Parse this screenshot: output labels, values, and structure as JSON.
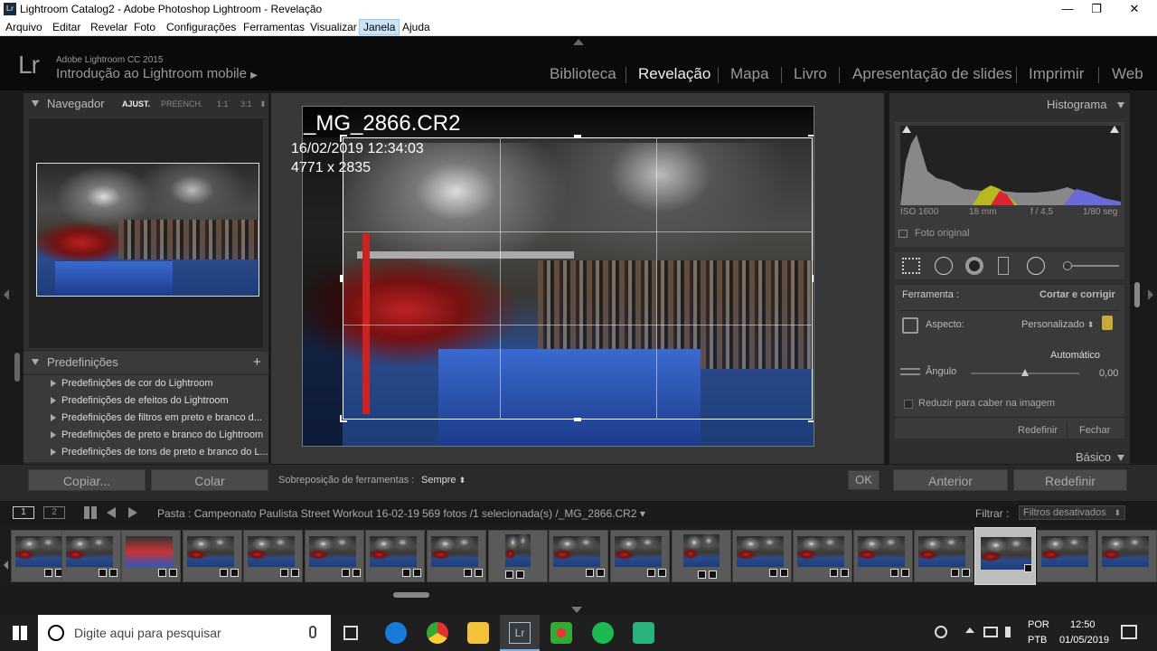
{
  "window": {
    "title": "Lightroom Catalog2 - Adobe Photoshop Lightroom - Revelação",
    "minimize": "—",
    "maximize": "❐",
    "close": "✕"
  },
  "menu": [
    "Arquivo",
    "Editar",
    "Revelar",
    "Foto",
    "Configurações",
    "Ferramentas",
    "Visualizar",
    "Janela",
    "Ajuda"
  ],
  "identity": {
    "logo": "Lr",
    "version": "Adobe Lightroom CC 2015",
    "intro": "Introdução ao Lightroom mobile",
    "intro_arrow": "▶"
  },
  "modules": [
    "Biblioteca",
    "Revelação",
    "Mapa",
    "Livro",
    "Apresentação de slides",
    "Imprimir",
    "Web"
  ],
  "navigator": {
    "title": "Navegador",
    "zoom": [
      "AJUST.",
      "PREENCH.",
      "1:1",
      "3:1"
    ],
    "stepper": "⬍"
  },
  "presets": {
    "title": "Predefinições",
    "add": "+",
    "items": [
      "Predefinições de cor do Lightroom",
      "Predefinições de efeitos do Lightroom",
      "Predefinições de filtros em preto e branco d...",
      "Predefinições de preto e branco do Lightroom",
      "Predefinições de tons de preto e branco do L..."
    ]
  },
  "left_buttons": {
    "copy": "Copiar...",
    "paste": "Colar"
  },
  "photo_info": {
    "filename": "_MG_2866.CR2",
    "datetime": "16/02/2019 12:34:03",
    "dimensions": "4771 x 2835"
  },
  "toolbar": {
    "overlay_label": "Sobreposição de ferramentas :",
    "overlay_value": "Sempre",
    "overlay_caret": "⬍",
    "ok": "OK"
  },
  "histogram": {
    "title": "Histograma",
    "iso": "ISO 1600",
    "focal": "18 mm",
    "aperture": "f / 4,5",
    "shutter": "1/80 seg",
    "original": "Foto original"
  },
  "crop": {
    "tool_label": "Ferramenta :",
    "tool_value": "Cortar e corrigir",
    "aspect_label": "Aspecto:",
    "aspect_value": "Personalizado",
    "aspect_caret": "⬍",
    "auto": "Automático",
    "angle_label": "Ângulo",
    "angle_value": "0,00",
    "angle_fraction": 0.5,
    "constrain": "Reduzir para caber na imagem",
    "reset": "Redefinir",
    "close": "Fechar"
  },
  "basic": {
    "title": "Básico"
  },
  "right_buttons": {
    "previous": "Anterior",
    "reset": "Redefinir"
  },
  "filmstrip_bar": {
    "view1": "1",
    "view2": "2",
    "folder": "Pasta : Campeonato Paulista Street Workout 16-02-19",
    "count": "569 fotos /1 selecionada(s) /_MG_2866.CR2",
    "caret": "▾",
    "filter_label": "Filtrar :",
    "filter_value": "Filtros desativados",
    "filter_caret": "⬍"
  },
  "taskbar": {
    "search_placeholder": "Digite aqui para pesquisar",
    "lang1": "POR",
    "lang2": "PTB",
    "time": "12:50",
    "date": "01/05/2019",
    "lr_tb": "Lr"
  },
  "colors": {
    "accent_selected": "#cce4f7",
    "panel": "#2f2f2f",
    "background": "#1a1a1a"
  }
}
